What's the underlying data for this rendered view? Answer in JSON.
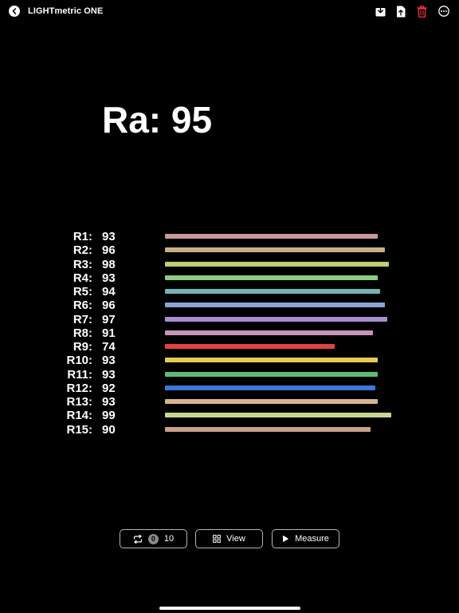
{
  "topbar": {
    "title": "LIGHTmetric ONE",
    "icons": {
      "back": "chevron-left-icon",
      "save": "tray-arrow-down-icon",
      "export": "document-arrow-up-icon",
      "delete": "trash-icon",
      "more": "ellipsis-circle-icon"
    },
    "delete_color": "#e5303a"
  },
  "ra": {
    "label": "Ra: 95"
  },
  "color_rendering": {
    "rows": [
      {
        "label": "R1:",
        "value": 93,
        "color": "#c99b95"
      },
      {
        "label": "R2:",
        "value": 96,
        "color": "#c9b084"
      },
      {
        "label": "R3:",
        "value": 98,
        "color": "#bdd075"
      },
      {
        "label": "R4:",
        "value": 93,
        "color": "#8fcb82"
      },
      {
        "label": "R5:",
        "value": 94,
        "color": "#74b3b3"
      },
      {
        "label": "R6:",
        "value": 96,
        "color": "#8ba3d4"
      },
      {
        "label": "R7:",
        "value": 97,
        "color": "#a88ed0"
      },
      {
        "label": "R8:",
        "value": 91,
        "color": "#c695b8"
      },
      {
        "label": "R9:",
        "value": 74,
        "color": "#e0433f"
      },
      {
        "label": "R10:",
        "value": 93,
        "color": "#e6cc56"
      },
      {
        "label": "R11:",
        "value": 93,
        "color": "#5cbb77"
      },
      {
        "label": "R12:",
        "value": 92,
        "color": "#3b79d6"
      },
      {
        "label": "R13:",
        "value": 93,
        "color": "#d8b392"
      },
      {
        "label": "R14:",
        "value": 99,
        "color": "#c6d98c"
      },
      {
        "label": "R15:",
        "value": 90,
        "color": "#c8a18a"
      }
    ]
  },
  "controls": {
    "repeat": {
      "icon": "repeat-icon",
      "badge": "0",
      "count": "10"
    },
    "view": {
      "icon": "grid-icon",
      "label": "View"
    },
    "measure": {
      "icon": "play-icon",
      "label": "Measure"
    }
  }
}
